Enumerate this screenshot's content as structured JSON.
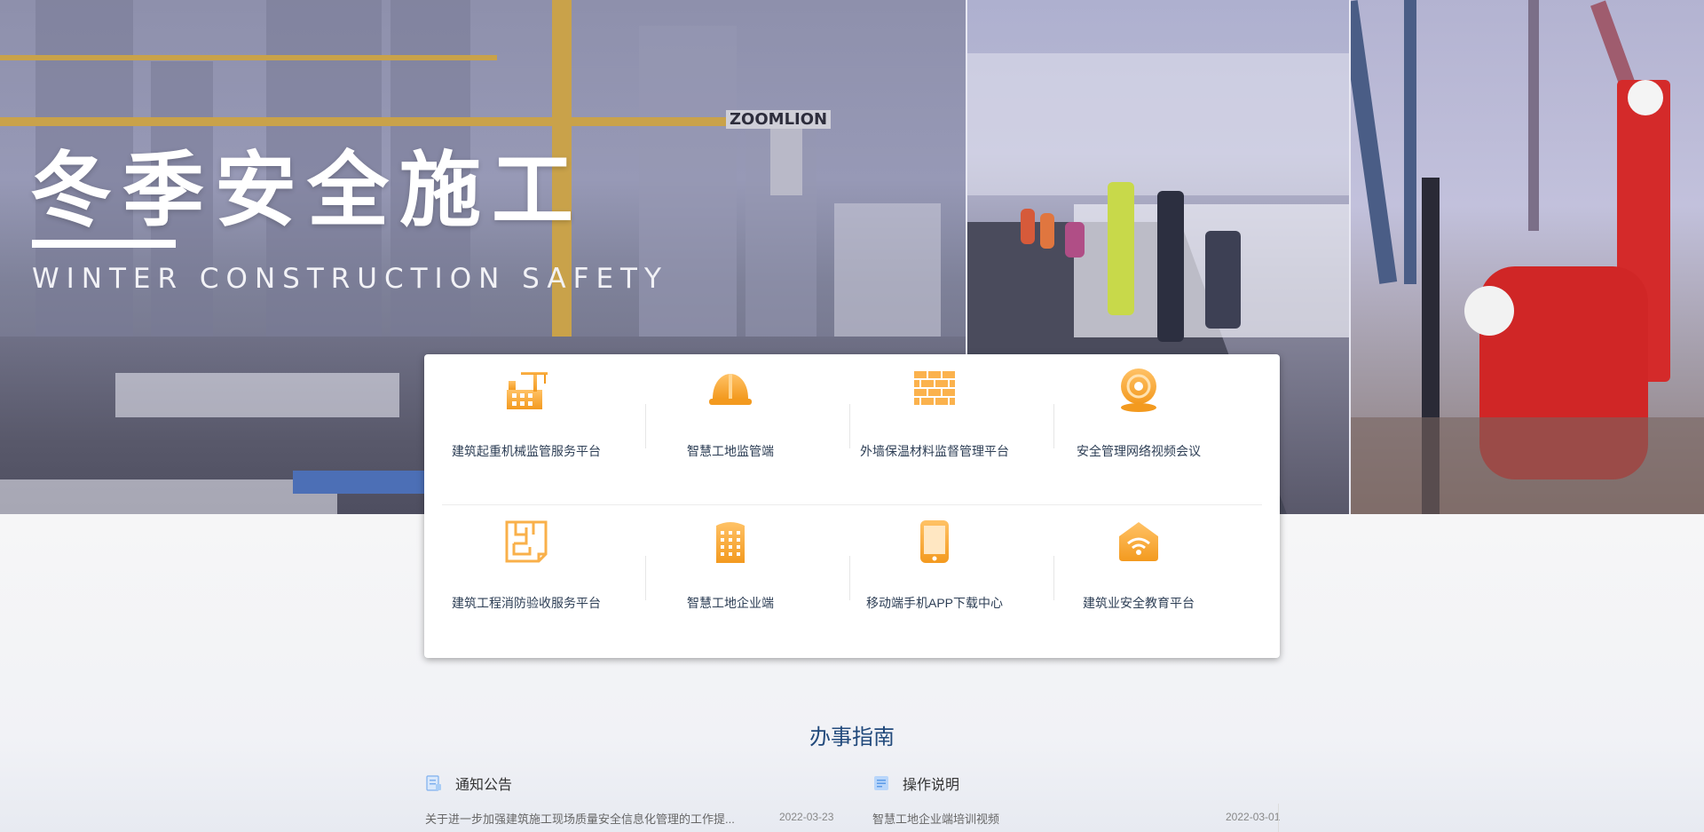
{
  "hero": {
    "title": "冬季安全施工",
    "subtitle": "WINTER CONSTRUCTION SAFETY",
    "crane_brand": "ZOOMLION"
  },
  "services": {
    "row1": [
      {
        "label": "建筑起重机械监管服务平台",
        "icon": "factory-crane-icon"
      },
      {
        "label": "智慧工地监管端",
        "icon": "safety-helmet-icon"
      },
      {
        "label": "外墙保温材料监督管理平台",
        "icon": "brick-wall-icon"
      },
      {
        "label": "安全管理网络视频会议",
        "icon": "webcam-icon"
      }
    ],
    "row2": [
      {
        "label": "建筑工程消防验收服务平台",
        "icon": "floor-plan-icon"
      },
      {
        "label": "智慧工地企业端",
        "icon": "office-building-icon"
      },
      {
        "label": "移动端手机APP下载中心",
        "icon": "mobile-phone-icon"
      },
      {
        "label": "建筑业安全教育平台",
        "icon": "wifi-house-icon"
      }
    ]
  },
  "guide": {
    "title": "办事指南",
    "notices": {
      "heading": "通知公告",
      "items": [
        {
          "text": "关于进一步加强建筑施工现场质量安全信息化管理的工作提...",
          "date": "2022-03-23"
        }
      ]
    },
    "instructions": {
      "heading": "操作说明",
      "items": [
        {
          "text": "智慧工地企业端培训视频",
          "date": "2022-03-01"
        }
      ]
    }
  },
  "colors": {
    "accent_orange": "#f5a02a",
    "heading_blue": "#224a7c",
    "label_text": "#2d3e55"
  }
}
